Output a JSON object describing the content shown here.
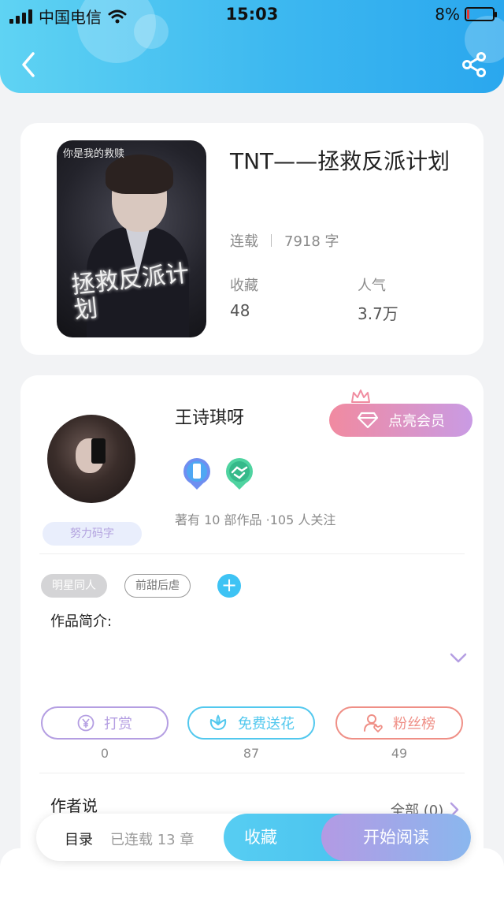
{
  "status_bar": {
    "carrier": "中国电信",
    "time": "15:03",
    "battery_percent": "8%",
    "battery_level": 0.08
  },
  "header": {
    "back_icon": "chevron-left-icon",
    "share_icon": "share-icon"
  },
  "book": {
    "cover_top_text": "你是我的救赎",
    "cover_title": "拯救反派计划",
    "title": "TNT——拯救反派计划",
    "status": "连载",
    "word_count": "7918 字",
    "stats": [
      {
        "label": "收藏",
        "value": "48"
      },
      {
        "label": "人气",
        "value": "3.7万"
      }
    ]
  },
  "author": {
    "name": "王诗琪呀",
    "badge": "努力码字",
    "vip_button": "点亮会员",
    "meta": "著有 10 部作品 ·105 人关注",
    "medal_icons": [
      "phone-medal-icon",
      "handshake-medal-icon"
    ]
  },
  "tags": {
    "items": [
      "明星同人",
      "前甜后虐"
    ],
    "add_icon": "plus-icon"
  },
  "intro": {
    "label": "作品简介:",
    "expand_icon": "chevron-down-icon"
  },
  "actions": [
    {
      "label": "打赏",
      "count": "0",
      "icon": "yen-icon",
      "color": "#b49ee2"
    },
    {
      "label": "免费送花",
      "count": "87",
      "icon": "flower-icon",
      "color": "#52c8ee"
    },
    {
      "label": "粉丝榜",
      "count": "49",
      "icon": "fans-icon",
      "color": "#ef8f86"
    }
  ],
  "author_says": {
    "label": "作者说",
    "all_link": "全部 (0)",
    "arrow_icon": "chevron-right-icon"
  },
  "bottom_bar": {
    "catalog": "目录",
    "chapters": "已连载 13 章",
    "collect": "收藏",
    "start_reading": "开始阅读"
  },
  "colors": {
    "header_gradient_start": "#5fd3f3",
    "header_gradient_end": "#2aa7ee",
    "vip_gradient_start": "#f18aa0",
    "vip_gradient_end": "#c99be4",
    "accent_blue": "#3ec3f4"
  }
}
